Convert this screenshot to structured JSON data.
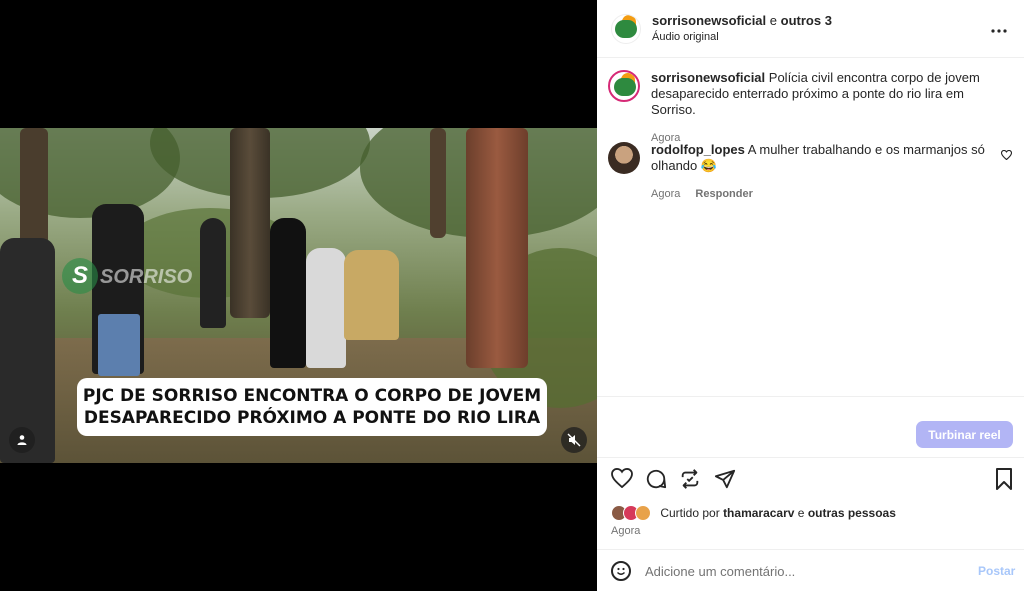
{
  "video": {
    "caption_line1": "PJC DE SORRISO ENCONTRA O CORPO DE JOVEM",
    "caption_line2": "DESAPARECIDO PRÓXIMO A PONTE DO RIO LIRA",
    "watermark": "SORRISO",
    "user_icon": "user-icon",
    "mute_icon": "volume-mute-icon"
  },
  "header": {
    "username": "sorrisonewsoficial",
    "connector": "e",
    "others": "outros 3",
    "audio": "Áudio original",
    "more_icon": "more-horizontal-icon"
  },
  "comments": [
    {
      "username": "sorrisonewsoficial",
      "text": "Polícia civil encontra corpo de jovem desaparecido enterrado próximo a ponte do rio lira em Sorriso.",
      "time": "Agora"
    },
    {
      "username": "rodolfop_lopes",
      "text": "A mulher trabalhando e os marmanjos só olhando 😂",
      "time": "Agora",
      "reply": "Responder"
    }
  ],
  "boost": {
    "label": "Turbinar reel"
  },
  "actions": {
    "like_icon": "heart-icon",
    "comment_icon": "comment-icon",
    "repost_icon": "repost-icon",
    "share_icon": "send-icon",
    "save_icon": "bookmark-icon"
  },
  "likes": {
    "prefix": "Curtido por",
    "user": "thamaracarv",
    "connector": "e",
    "others": "outras pessoas",
    "time": "Agora"
  },
  "add_comment": {
    "placeholder": "Adicione um comentário...",
    "post_label": "Postar"
  },
  "colors": {
    "accent_blue": "#0095f6",
    "boost_button": "#b2b5f5",
    "post_disabled": "#a8c7fa"
  }
}
